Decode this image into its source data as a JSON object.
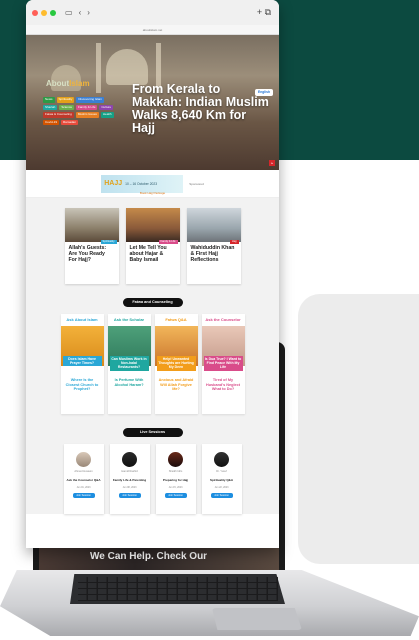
{
  "colors": {
    "brand_dark_green": "#0c4a40",
    "accent_orange": "#f29d1b",
    "hero_red": "#d6262b",
    "button_blue": "#1d8ee0"
  },
  "browser": {
    "url_text": "aboutislam.net"
  },
  "hero": {
    "logo_prefix": "About",
    "logo_suffix": "Islam",
    "title": "From Kerala to Makkah: Indian Muslim Walks 8,640 Km for Hajj",
    "language_button": "English",
    "categories": [
      {
        "label": "News",
        "color": "#2d9a46"
      },
      {
        "label": "Spirituality",
        "color": "#e4a018"
      },
      {
        "label": "Discovering Islam",
        "color": "#3a7fd4"
      },
      {
        "label": "Shariah",
        "color": "#1fa7a0"
      },
      {
        "label": "Science",
        "color": "#6ab04c"
      },
      {
        "label": "Family & Life",
        "color": "#d94c8a"
      },
      {
        "label": "Culture",
        "color": "#8e44ad"
      },
      {
        "label": "Fatwa & Counseling",
        "color": "#c0392b"
      },
      {
        "label": "Muslim Issues",
        "color": "#e67e22"
      },
      {
        "label": "Health",
        "color": "#16a085"
      },
      {
        "label": "Covid-19",
        "color": "#d35400"
      },
      {
        "label": "Ramadan",
        "color": "#e74c3c"
      }
    ]
  },
  "ad": {
    "hajj": "HAJJ",
    "dates": "10 – 16 October 2023",
    "sponsor": "Sponsored",
    "link": "Book Hajj Package"
  },
  "articles": [
    {
      "title": "Allah's Guests: Are You Ready For Hajj?",
      "tag": "Spirituality",
      "tag_color": "#2aa7d6",
      "img": "linear-gradient(180deg,#c8c4b8,#8b7f6a 60%,#5b4a3a)"
    },
    {
      "title": "Let Me Tell You about Hajar & Baby Ismail",
      "tag": "Family & Life",
      "tag_color": "#d94c8a",
      "img": "linear-gradient(180deg,#c58a4a,#8a5a3a 60%,#3a2a22)"
    },
    {
      "title": "Wahiduddin Khan & First Hajj Reflections",
      "tag": "Hajj",
      "tag_color": "#d6262b",
      "img": "linear-gradient(180deg,#cfd6dc,#9aa6ad 60%,#6d7378)"
    }
  ],
  "fatwa_section": {
    "title": "Fatwa and Counseling",
    "cards": [
      {
        "head": "Ask About Islam",
        "head_color": "#2aa7d6",
        "img": "linear-gradient(180deg,#f3b13a,#d88a1a)",
        "question": "Does Islam Have Prayer Times?",
        "q_color": "#2aa7d6",
        "bottom": "Where Is the Closest Church to Prophet?",
        "bottom_color": "#2aa7d6"
      },
      {
        "head": "Ask the Scholar",
        "head_color": "#1fa7a0",
        "img": "linear-gradient(180deg,#4ea07a,#2f7a5c)",
        "question": "Can Muslims Work in Non-halal Restaurants?",
        "q_color": "#1fa7a0",
        "bottom": "Is Perfume With Alcohol Haram?",
        "bottom_color": "#1fa7a0"
      },
      {
        "head": "Fatwa Q&A",
        "head_color": "#f29d1b",
        "img": "linear-gradient(180deg,#f2b65a,#c9742c)",
        "question": "Help! Unwanted Thoughts are Hurting My Deen",
        "q_color": "#f29d1b",
        "bottom": "Anxious and Afraid Will Allah Forgive Me?",
        "bottom_color": "#f29d1b"
      },
      {
        "head": "Ask the Counselor",
        "head_color": "#d94c8a",
        "img": "linear-gradient(180deg,#e9c8b8,#c49a8a)",
        "question": "Is Dua True? I Want to Find Peace With My Life",
        "q_color": "#d94c8a",
        "bottom": "Tired of My Husband's Neglect What to Do?",
        "bottom_color": "#d94c8a"
      }
    ]
  },
  "live_section": {
    "title": "Live Sessions",
    "cards": [
      {
        "name": "Ahmed Hussein",
        "title": "Ask the Counselor Q&A",
        "time": "Jun 01, 2023",
        "button": "Join Session",
        "avatar": "linear-gradient(180deg,#d8c8b8,#9a8878)"
      },
      {
        "name": "Hamid Rashid",
        "title": "Family Life & Parenting",
        "time": "Jun 08, 2023",
        "button": "Join Session",
        "avatar": "linear-gradient(180deg,#2a2a2a,#111)"
      },
      {
        "name": "Sheikh Idris",
        "title": "Preparing for Hajj",
        "time": "Jun 15, 2023",
        "button": "Join Session",
        "avatar": "linear-gradient(180deg,#6a2a1a,#1a0a0a)"
      },
      {
        "name": "Dr. Yusuf",
        "title": "Spirituality Q&A",
        "time": "Jun 22, 2023",
        "button": "Join Session",
        "avatar": "linear-gradient(180deg,#333,#111)"
      }
    ]
  },
  "footer": {
    "text": "We Can Help. Check Our"
  }
}
